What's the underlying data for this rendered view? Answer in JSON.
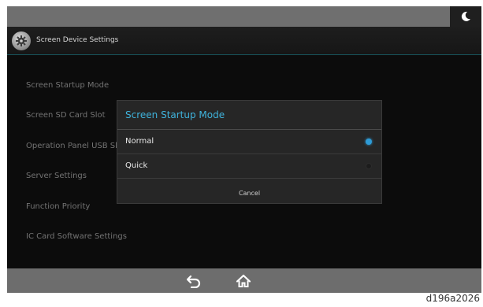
{
  "header": {
    "title": "Screen Device Settings"
  },
  "menu": {
    "items": [
      {
        "label": "Screen Startup Mode"
      },
      {
        "label": "Screen SD Card Slot"
      },
      {
        "label": "Operation Panel USB Sl"
      },
      {
        "label": "Server Settings"
      },
      {
        "label": "Function Priority"
      },
      {
        "label": "IC Card Software Settings"
      }
    ]
  },
  "dialog": {
    "title": "Screen Startup Mode",
    "options": [
      {
        "label": "Normal",
        "selected": true
      },
      {
        "label": "Quick",
        "selected": false
      }
    ],
    "cancel_label": "Cancel"
  },
  "icons": {
    "status": "moon-icon",
    "title": "gear-icon",
    "back": "back-arrow-icon",
    "home": "home-icon"
  },
  "colors": {
    "accent": "#3fb3dc",
    "radio_selected": "#2e9bd6"
  },
  "caption": "d196a2026"
}
